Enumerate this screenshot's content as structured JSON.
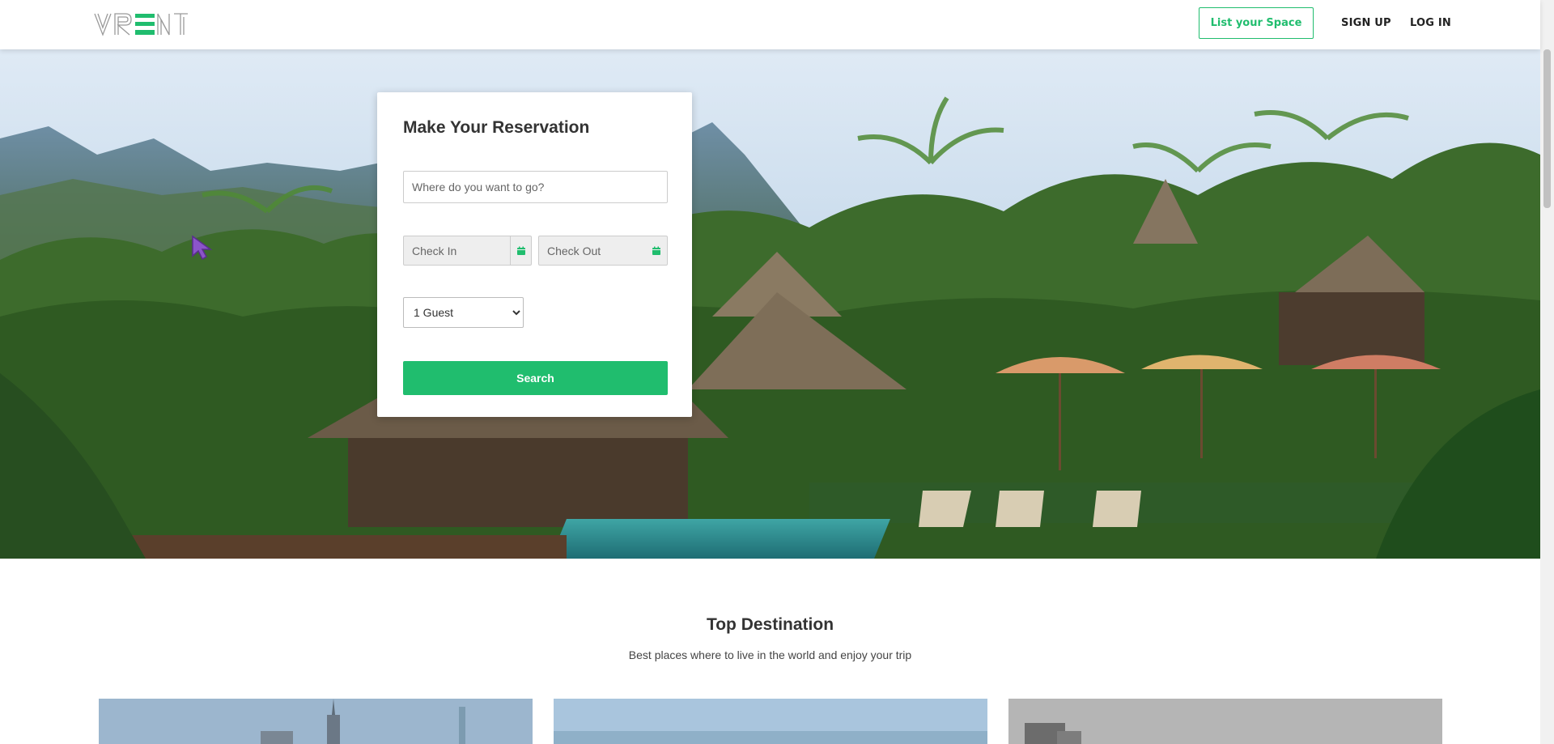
{
  "header": {
    "logo_text": "VRENT",
    "list_space_label": "List your Space",
    "signup_label": "SIGN UP",
    "login_label": "LOG IN"
  },
  "reservation": {
    "title": "Make Your Reservation",
    "destination_placeholder": "Where do you want to go?",
    "destination_value": "",
    "checkin_placeholder": "Check In",
    "checkout_placeholder": "Check Out",
    "guest_selected": "1 Guest",
    "search_label": "Search"
  },
  "top_destination": {
    "title": "Top Destination",
    "subtitle": "Best places where to live in the world and enjoy your trip"
  },
  "colors": {
    "brand_green": "#20bd6e"
  },
  "icons": {
    "calendar": "calendar-icon",
    "cursor": "mouse-cursor-icon",
    "select_arrow": "chevron-down-icon"
  }
}
